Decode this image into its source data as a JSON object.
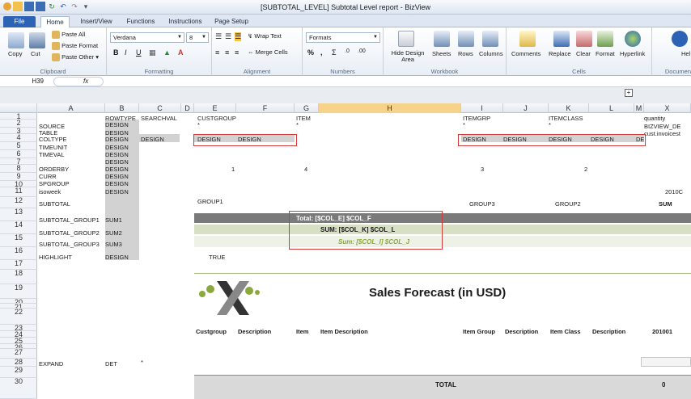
{
  "window": {
    "title": "[SUBTOTAL_LEVEL] Subtotal Level report - BizView"
  },
  "tabs": [
    {
      "label": "File"
    },
    {
      "label": "Home"
    },
    {
      "label": "Insert/View"
    },
    {
      "label": "Functions"
    },
    {
      "label": "Instructions"
    },
    {
      "label": "Page Setup"
    }
  ],
  "ribbon": {
    "clipboard": {
      "label": "Clipboard",
      "copy": "Copy",
      "cut": "Cut",
      "paste_all": "Paste All",
      "paste_format": "Paste Format",
      "paste_other": "Paste Other ▾"
    },
    "formatting": {
      "label": "Formatting",
      "font": "Verdana",
      "size": "8"
    },
    "alignment": {
      "label": "Alignment",
      "wrap": "Wrap Text",
      "merge": "Merge Cells"
    },
    "numbers": {
      "label": "Numbers",
      "formats": "Formats",
      "pct": "%",
      "comma": ","
    },
    "workbook": {
      "label": "Workbook",
      "hide_design": "Hide Design Area",
      "sheets": "Sheets",
      "rows": "Rows",
      "columns": "Columns"
    },
    "cells": {
      "label": "Cells",
      "comments": "Comments",
      "replace": "Replace",
      "clear": "Clear",
      "format": "Format",
      "hyperlink": "Hyperlink"
    },
    "help": {
      "label": "Documen",
      "help": "Hel"
    }
  },
  "formula_bar": {
    "cell_ref": "H39",
    "fx": "fx"
  },
  "columns": [
    "A",
    "B",
    "C",
    "D",
    "E",
    "F",
    "G",
    "H",
    "I",
    "J",
    "K",
    "L",
    "M",
    "X"
  ],
  "rows": [
    "1",
    "2",
    "3",
    "4",
    "5",
    "6",
    "7",
    "8",
    "9",
    "10",
    "11",
    "12",
    "13",
    "14",
    "15",
    "16",
    "17",
    "18",
    "19",
    "20",
    "21",
    "22",
    "23",
    "24",
    "25",
    "26",
    "27",
    "28",
    "29",
    "30"
  ],
  "cells": {
    "r1": {
      "b": "ROWTYPE",
      "c": "SEARCHVAL",
      "e": "CUSTGROUP",
      "g": "ITEM",
      "i": "ITEMGRP",
      "k": "ITEMCLASS",
      "x": "quantity"
    },
    "r2": {
      "a": "SOURCE",
      "b": "DESIGN",
      "e": "*",
      "g": "*",
      "i": "*",
      "k": "*",
      "x": "BIZVIEW_DE"
    },
    "r3": {
      "a": "TABLE",
      "b": "DESIGN",
      "x": "cust.invoicest"
    },
    "r4": {
      "a": "COLTYPE",
      "b": "DESIGN",
      "c": "DESIGN",
      "e": "DESIGN",
      "f": "DESIGN",
      "i": "DESIGN",
      "j": "DESIGN",
      "k": "DESIGN",
      "l": "DESIGN",
      "m": "DE"
    },
    "r5": {
      "a": "TIMEUNIT",
      "b": "DESIGN"
    },
    "r6": {
      "a": "TIMEVAL",
      "b": "DESIGN"
    },
    "r7": {
      "b": "DESIGN"
    },
    "r8": {
      "a": "ORDERBY",
      "b": "DESIGN",
      "e": "1",
      "g": "4",
      "i": "3",
      "k": "2"
    },
    "r9": {
      "a": "CURR",
      "b": "DESIGN"
    },
    "r10": {
      "a": "SPGROUP",
      "b": "DESIGN"
    },
    "r11": {
      "a": "isoweek",
      "b": "DESIGN",
      "x": "2010C"
    },
    "r12": {
      "a": "SUBTOTAL",
      "e": "GROUP1",
      "i": "GROUP3",
      "k": "GROUP2",
      "x": "SUM"
    },
    "r13": {
      "a": "SUBTOTAL_GROUP1",
      "b": "SUM1",
      "total": "Total: [$COL_E] $COL_F"
    },
    "r14": {
      "a": "SUBTOTAL_GROUP2",
      "b": "SUM2",
      "sum": "SUM: [$COL_K] $COL_L"
    },
    "r15": {
      "a": "SUBTOTAL_GROUP3",
      "b": "SUM3",
      "sum": "Sum: [$COL_I] $COL_J"
    },
    "r16": {
      "a": "HIGHLIGHT",
      "b": "DESIGN",
      "e": "TRUE"
    },
    "r27": {
      "a": "EXPAND",
      "b": "DET",
      "c": "*"
    },
    "r29": {
      "total": "TOTAL",
      "x": "0"
    }
  },
  "report": {
    "title": "Sales Forecast (in USD)",
    "headers": [
      "Custgroup",
      "Description",
      "Item",
      "Item Description",
      "Item Group",
      "Description",
      "Item Class",
      "Description",
      "201001"
    ]
  },
  "colors": {
    "shade": "#d2d2d2",
    "red_outline": "#d23a3a",
    "band_dark": "#7a7a7a",
    "band_mid": "#d7dfc4",
    "band_light": "#eef1e6",
    "accent_green": "#8aa83c",
    "selected_column": "#f7d28b"
  }
}
